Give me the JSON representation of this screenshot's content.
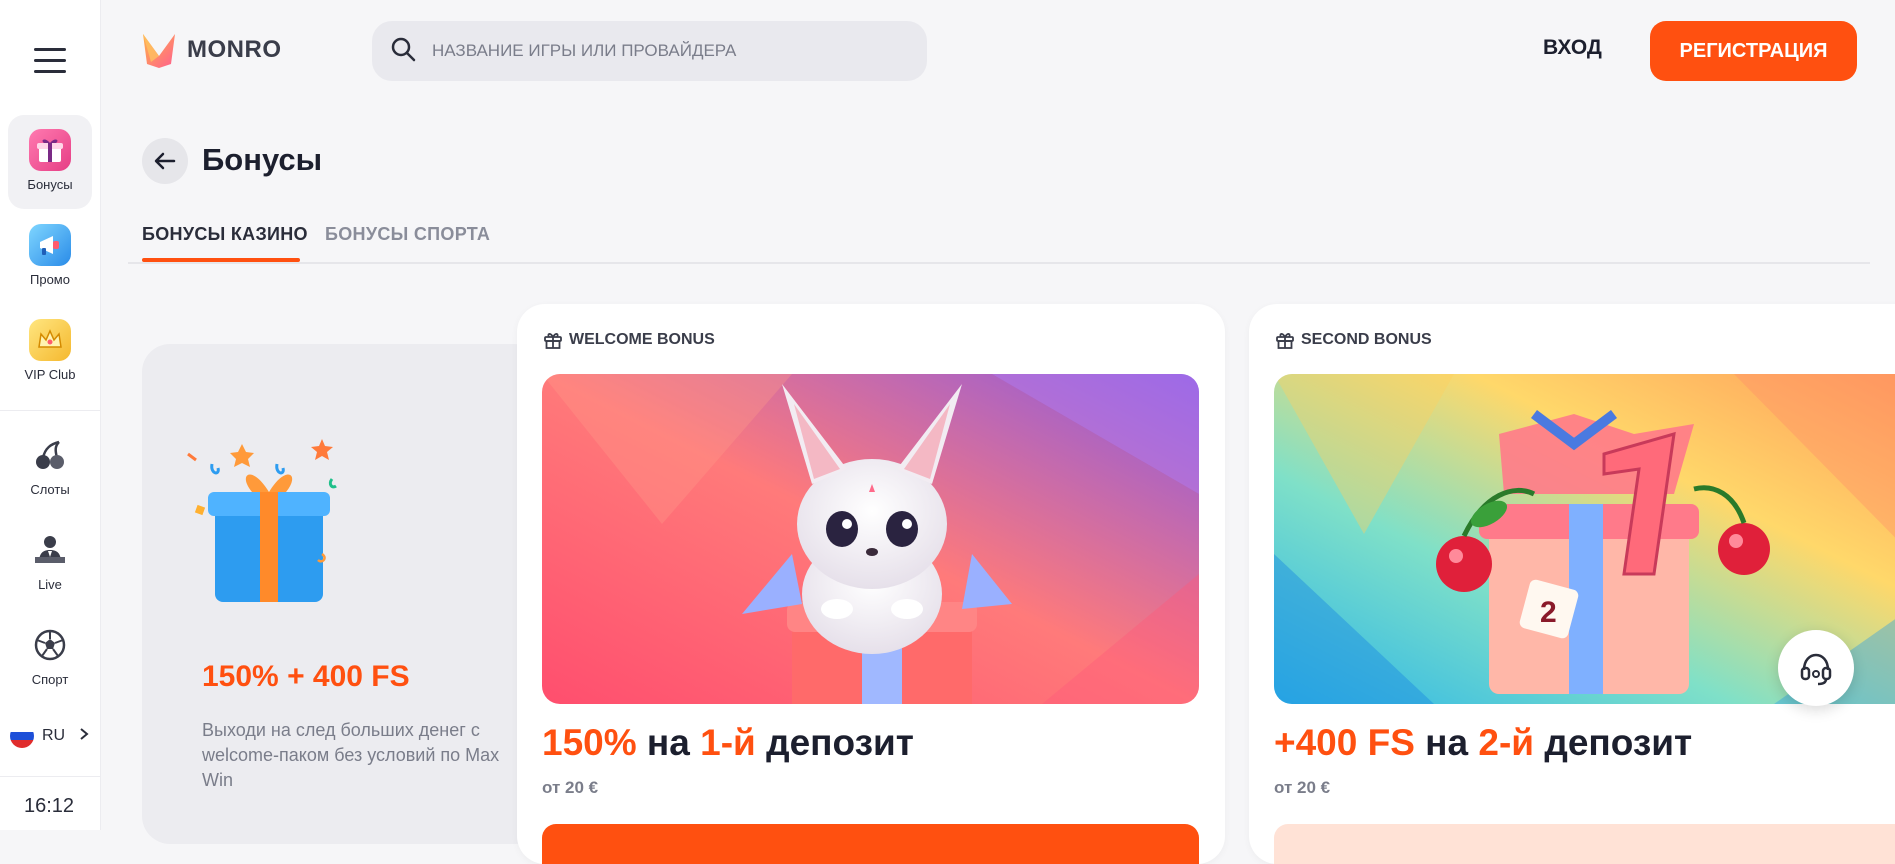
{
  "sidebar": {
    "items": [
      {
        "label": "Бонусы",
        "icon": "gift-icon",
        "active": true
      },
      {
        "label": "Промо",
        "icon": "megaphone-icon"
      },
      {
        "label": "VIP Club",
        "icon": "crown-icon"
      },
      {
        "label": "Слоты",
        "icon": "cherries-icon"
      },
      {
        "label": "Live",
        "icon": "dealer-icon"
      },
      {
        "label": "Спорт",
        "icon": "soccer-ball-icon"
      }
    ],
    "language": "RU",
    "time": "16:12"
  },
  "header": {
    "logo_text": "MONRO",
    "search_placeholder": "НАЗВАНИЕ ИГРЫ ИЛИ ПРОВАЙДЕРА",
    "login_label": "ВХОД",
    "register_label": "РЕГИСТРАЦИЯ"
  },
  "page": {
    "title": "Бонусы",
    "tabs": [
      {
        "label": "БОНУСЫ КАЗИНО",
        "active": true
      },
      {
        "label": "БОНУСЫ СПОРТА",
        "active": false
      }
    ]
  },
  "promo_card": {
    "amount": "150% + 400 FS",
    "description": "Выходи на след больших денег с welcome-паком без условий по Max Win"
  },
  "bonus_cards": [
    {
      "tag": "WELCOME BONUS",
      "heading_hl1": "150%",
      "heading_mid": " на ",
      "heading_hl2": "1-й",
      "heading_end": " депозит",
      "min_deposit": "от 20 €"
    },
    {
      "tag": "SECOND BONUS",
      "heading_hl1": "+400 FS",
      "heading_mid": " на ",
      "heading_hl2": "2-й",
      "heading_end": " депозит",
      "min_deposit": "от 20 €"
    }
  ],
  "colors": {
    "accent": "#ff5010",
    "text": "#1c1f2e",
    "muted": "#7a7d8a"
  }
}
